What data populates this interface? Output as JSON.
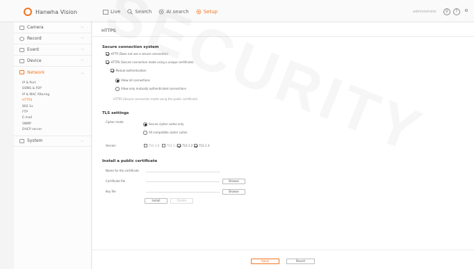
{
  "brand": {
    "name": "Hanwha Vision",
    "accent": "#f37321"
  },
  "topnav": [
    {
      "label": "Live",
      "icon": "live-icon",
      "active": false
    },
    {
      "label": "Search",
      "icon": "search-icon",
      "active": false
    },
    {
      "label": "AI search",
      "icon": "ai-search-icon",
      "active": false
    },
    {
      "label": "Setup",
      "icon": "setup-icon",
      "active": true
    }
  ],
  "top_right": {
    "user": "administrator"
  },
  "sidebar": {
    "menus": [
      {
        "label": "Camera",
        "icon": "camera-icon"
      },
      {
        "label": "Record",
        "icon": "record-icon"
      },
      {
        "label": "Event",
        "icon": "event-icon"
      },
      {
        "label": "Device",
        "icon": "device-icon"
      },
      {
        "label": "Network",
        "icon": "network-icon",
        "active": true
      },
      {
        "label": "System",
        "icon": "system-icon"
      }
    ],
    "network_items": [
      "IP & Port",
      "DDNS & P2P",
      "IP & MAC filtering",
      "HTTPS",
      "802.1x",
      "FTP",
      "E-mail",
      "SNMP",
      "DHCP server"
    ],
    "active_item": "HTTPS"
  },
  "page": {
    "title": "HTTPS",
    "secure": {
      "heading": "Secure connection system",
      "opt1": "HTTP (Does not use a secure connection)",
      "opt2": "HTTPS (Secure connection mode using a unique certificate)",
      "mutual": "Mutual authentication",
      "allow_all": "Allow all connections",
      "allow_only": "Allow only mutually authenticated connections",
      "public_cert": "HTTPS (Secure connection mode using the public certificate)"
    },
    "tls": {
      "heading": "TLS settings",
      "cipher_label": "Cipher mode",
      "cipher_opt1": "Secure cipher suites only",
      "cipher_opt2": "All compatible cipher suites",
      "version_label": "Version",
      "versions": [
        {
          "label": "TLS 1.0",
          "checked": false
        },
        {
          "label": "TLS 1.1",
          "checked": false
        },
        {
          "label": "TLS 1.2",
          "checked": true
        },
        {
          "label": "TLS 1.3",
          "checked": true
        }
      ]
    },
    "install": {
      "heading": "Install a public certificate",
      "name_label": "Name for the certificate",
      "cert_label": "Certificate file",
      "key_label": "Key file",
      "browse": "Browse",
      "install": "Install",
      "delete": "Delete"
    },
    "footer": {
      "apply": "Apply",
      "revert": "Revert"
    }
  },
  "watermark": "SECURITY"
}
